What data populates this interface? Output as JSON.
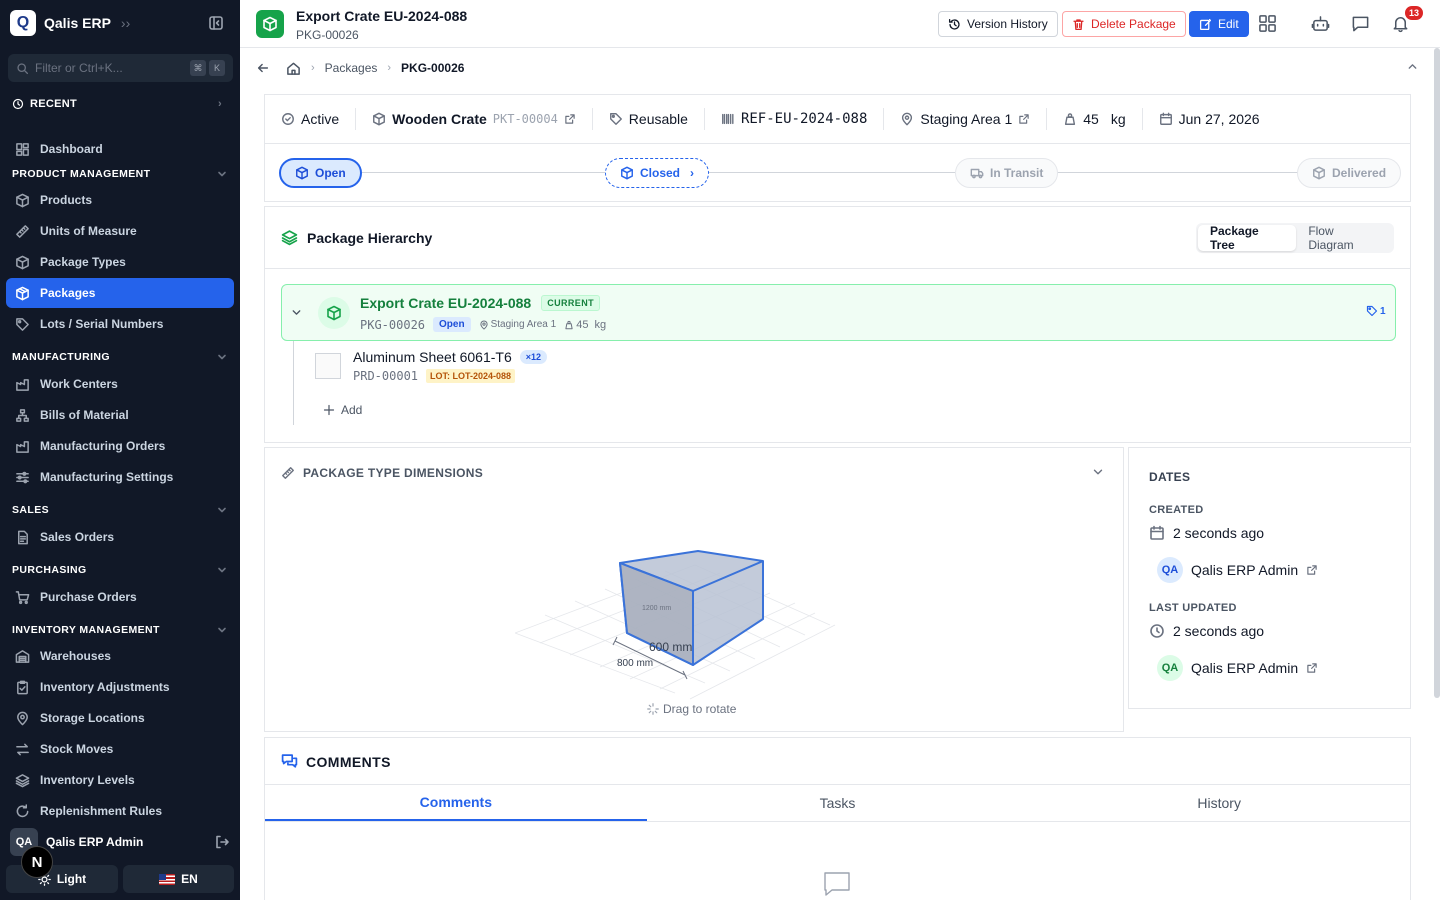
{
  "app": {
    "logo_letter": "Q",
    "name": "Qalis ERP"
  },
  "sidebar": {
    "filter_placeholder": "Filter or Ctrl+K...",
    "filter_keys": [
      "⌘",
      "K"
    ],
    "recent_label": "RECENT",
    "dashboard": "Dashboard",
    "sections": {
      "product": "PRODUCT MANAGEMENT",
      "manufacturing": "MANUFACTURING",
      "sales": "SALES",
      "purchasing": "PURCHASING",
      "inventory": "INVENTORY MANAGEMENT"
    },
    "product_items": [
      "Products",
      "Units of Measure",
      "Package Types",
      "Packages",
      "Lots / Serial Numbers"
    ],
    "manufacturing_items": [
      "Work Centers",
      "Bills of Material",
      "Manufacturing Orders",
      "Manufacturing Settings"
    ],
    "sales_items": [
      "Sales Orders"
    ],
    "purchasing_items": [
      "Purchase Orders"
    ],
    "inventory_items": [
      "Warehouses",
      "Inventory Adjustments",
      "Storage Locations",
      "Stock Moves",
      "Inventory Levels",
      "Replenishment Rules"
    ],
    "user": {
      "initials": "QA",
      "name": "Qalis ERP Admin"
    },
    "theme_label": "Light",
    "lang_label": "EN",
    "n_badge": "N"
  },
  "header": {
    "title": "Export Crate EU-2024-088",
    "subtitle": "PKG-00026",
    "version_history": "Version History",
    "delete": "Delete Package",
    "edit": "Edit",
    "notifications": "13"
  },
  "breadcrumb": {
    "parent": "Packages",
    "current": "PKG-00026"
  },
  "info": {
    "status": "Active",
    "package_type": "Wooden Crate",
    "package_type_code": "PKT-00004",
    "reusable": "Reusable",
    "reference": "REF-EU-2024-088",
    "location": "Staging Area 1",
    "weight_value": "45",
    "weight_unit": "kg",
    "date": "Jun 27, 2026"
  },
  "steps": [
    "Open",
    "Closed",
    "In Transit",
    "Delivered"
  ],
  "hierarchy": {
    "title": "Package Hierarchy",
    "tabs": [
      "Package Tree",
      "Flow Diagram"
    ],
    "root": {
      "name": "Export Crate EU-2024-088",
      "badge": "CURRENT",
      "code": "PKG-00026",
      "status": "Open",
      "location": "Staging Area 1",
      "weight": "45  kg",
      "count": "1"
    },
    "child": {
      "name": "Aluminum Sheet 6061-T6",
      "qty": "×12",
      "code": "PRD-00001",
      "lot": "LOT: LOT-2024-088"
    },
    "add_label": "Add"
  },
  "dimensions": {
    "title": "PACKAGE TYPE DIMENSIONS",
    "height_label": "1200 mm",
    "width_label": "600 mm",
    "length_label": "800 mm",
    "hint": "Drag to rotate"
  },
  "dates": {
    "title": "DATES",
    "created_label": "CREATED",
    "created_value": "2 seconds ago",
    "created_by_initials": "QA",
    "created_by": "Qalis ERP Admin",
    "updated_label": "LAST UPDATED",
    "updated_value": "2 seconds ago",
    "updated_by_initials": "QA",
    "updated_by": "Qalis ERP Admin"
  },
  "comments": {
    "title": "COMMENTS",
    "tabs": [
      "Comments",
      "Tasks",
      "History"
    ]
  },
  "colors": {
    "primary": "#2563eb",
    "sidebar": "#111827",
    "success": "#16a34a",
    "danger": "#dc2626"
  }
}
